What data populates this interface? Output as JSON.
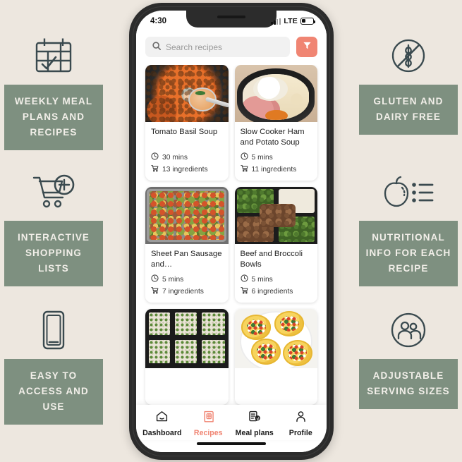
{
  "theme": {
    "background": "#EDE7DF",
    "badge_green": "#7E9080",
    "badge_text": "#F2EFE9",
    "accent_coral": "#F08573",
    "icon_outline": "#3A4A4F",
    "phone_frame": "#2C2C2C"
  },
  "features": {
    "left": [
      {
        "icon": "calendar-check-icon",
        "label": "Weekly meal plans and recipes"
      },
      {
        "icon": "shopping-cart-plus-icon",
        "label": "Interactive shopping lists"
      },
      {
        "icon": "mobile-phone-icon",
        "label": "Easy to access and use"
      }
    ],
    "right": [
      {
        "icon": "no-gluten-wheat-icon",
        "label": "Gluten and dairy free"
      },
      {
        "icon": "apple-nutrition-list-icon",
        "label": "Nutritional info for each recipe"
      },
      {
        "icon": "two-people-circle-icon",
        "label": "Adjustable serving sizes"
      }
    ]
  },
  "phone": {
    "status_bar": {
      "time": "4:30",
      "network": "LTE",
      "signal_icon": "signal-bars-icon",
      "battery_icon": "battery-icon"
    },
    "search": {
      "placeholder": "Search recipes",
      "value": "",
      "search_icon": "search-icon",
      "filter_icon": "filter-funnel-icon"
    },
    "recipes": [
      {
        "title": "Tomato Basil Soup",
        "time": "30 mins",
        "ingredients": "13 ingredients",
        "image": "tomato-basil-soup-photo",
        "time_icon": "clock-icon",
        "ingredients_icon": "cart-icon"
      },
      {
        "title": "Slow Cooker Ham and Potato Soup",
        "time": "5 mins",
        "ingredients": "11 ingredients",
        "image": "slow-cooker-ham-potato-soup-photo",
        "time_icon": "clock-icon",
        "ingredients_icon": "cart-icon"
      },
      {
        "title": "Sheet Pan Sausage and…",
        "time": "5 mins",
        "ingredients": "7 ingredients",
        "image": "sheet-pan-sausage-veggies-photo",
        "time_icon": "clock-icon",
        "ingredients_icon": "cart-icon"
      },
      {
        "title": "Beef and Broccoli Bowls",
        "time": "5 mins",
        "ingredients": "6 ingredients",
        "image": "beef-broccoli-bowls-photo",
        "time_icon": "clock-icon",
        "ingredients_icon": "cart-icon"
      },
      {
        "title": "",
        "time": "",
        "ingredients": "",
        "image": "meal-prep-rice-containers-photo",
        "time_icon": "clock-icon",
        "ingredients_icon": "cart-icon"
      },
      {
        "title": "",
        "time": "",
        "ingredients": "",
        "image": "egg-muffin-cups-photo",
        "time_icon": "clock-icon",
        "ingredients_icon": "cart-icon"
      }
    ],
    "tabs": [
      {
        "label": "Dashboard",
        "icon": "home-icon",
        "active": false
      },
      {
        "label": "Recipes",
        "icon": "recipe-book-icon",
        "active": true
      },
      {
        "label": "Meal plans",
        "icon": "meal-plan-clipboard-icon",
        "active": false
      },
      {
        "label": "Profile",
        "icon": "person-icon",
        "active": false
      }
    ]
  }
}
